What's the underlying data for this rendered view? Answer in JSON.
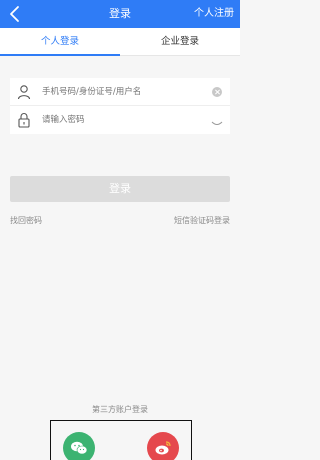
{
  "header": {
    "title": "登录",
    "register_label": "个人注册"
  },
  "tabs": [
    {
      "label": "个人登录"
    },
    {
      "label": "企业登录"
    }
  ],
  "form": {
    "username_placeholder": "手机号码/身份证号/用户名",
    "password_placeholder": "请输入密码"
  },
  "actions": {
    "login_label": "登录",
    "forgot_label": "找回密码",
    "sms_login_label": "短信验证码登录"
  },
  "third_party": {
    "title": "第三方账户登录"
  },
  "colors": {
    "primary": "#2f7cf6",
    "wechat": "#3cb371",
    "weibo": "#e5484d",
    "disabled_button": "#dcdcdc"
  }
}
